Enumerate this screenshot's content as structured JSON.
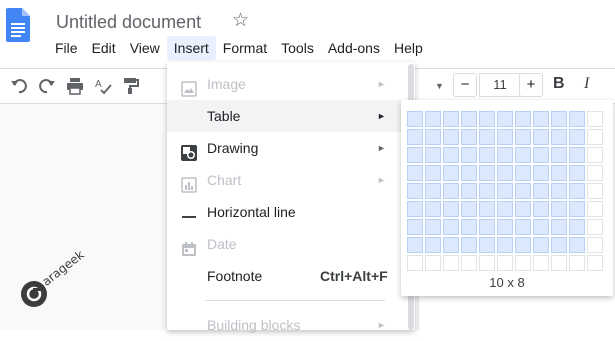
{
  "document": {
    "title": "Untitled document"
  },
  "menubar": [
    "File",
    "Edit",
    "View",
    "Insert",
    "Format",
    "Tools",
    "Add-ons",
    "Help"
  ],
  "toolbar": {
    "font_size": "11",
    "decrease_label": "−",
    "increase_label": "+",
    "bold_label": "B",
    "italic_label": "I"
  },
  "insert_menu": {
    "items": [
      {
        "label": "Image",
        "icon": "image-icon",
        "submenu": true,
        "disabled": true
      },
      {
        "label": "Table",
        "icon": "",
        "submenu": true,
        "disabled": false,
        "highlighted": true
      },
      {
        "label": "Drawing",
        "icon": "drawing-icon",
        "submenu": true,
        "disabled": false
      },
      {
        "label": "Chart",
        "icon": "chart-icon",
        "submenu": true,
        "disabled": true
      },
      {
        "label": "Horizontal line",
        "icon": "horizontal-line-icon",
        "submenu": false,
        "disabled": false
      },
      {
        "label": "Date",
        "icon": "date-icon",
        "submenu": false,
        "disabled": true
      },
      {
        "label": "Footnote",
        "icon": "",
        "shortcut": "Ctrl+Alt+F",
        "submenu": false,
        "disabled": false
      },
      {
        "label": "Building blocks",
        "icon": "",
        "submenu": true,
        "disabled": true
      }
    ],
    "arrow": "►"
  },
  "table_picker": {
    "columns": 11,
    "rows": 9,
    "selected_columns": 10,
    "selected_rows": 8,
    "size_label": "10 x 8"
  },
  "watermark": {
    "text": "arageek"
  },
  "colors": {
    "accent_blue": "#4285f4",
    "menu_active": "#e8f0fe",
    "cell_selected": "#dce8fc",
    "cell_border": "#e2e3e5"
  }
}
